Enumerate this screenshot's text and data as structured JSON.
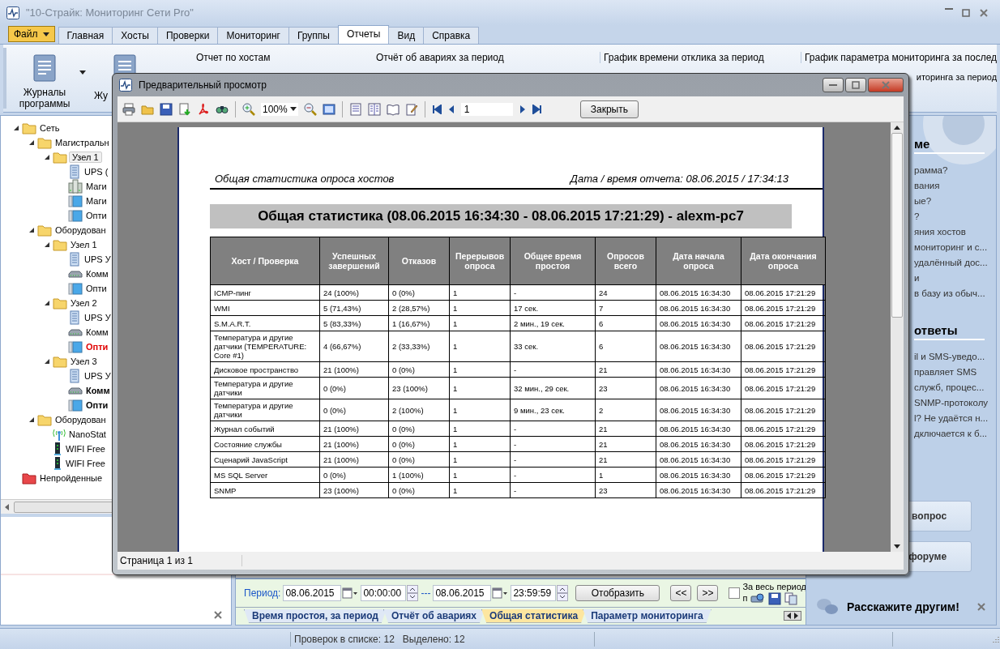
{
  "window": {
    "title": "\"10-Страйк: Мониторинг Сети Pro\""
  },
  "ribbon": {
    "file_menu": "Файл",
    "tabs": [
      {
        "label": "Главная",
        "selected": false
      },
      {
        "label": "Хосты",
        "selected": false
      },
      {
        "label": "Проверки",
        "selected": false
      },
      {
        "label": "Мониторинг",
        "selected": false
      },
      {
        "label": "Группы",
        "selected": false
      },
      {
        "label": "Отчеты",
        "selected": true
      },
      {
        "label": "Вид",
        "selected": false
      },
      {
        "label": "Справка",
        "selected": false
      }
    ],
    "big_buttons": [
      "Журналы программы",
      "Жу"
    ],
    "links": [
      "Отчет по хостам",
      "Отчёт об авариях за период",
      "График времени отклика за период",
      "График параметра мониторинга за послед"
    ],
    "links_row_2": [
      "иторинга за период"
    ]
  },
  "tree": [
    {
      "label": "Сеть",
      "kind": "folder",
      "expanded": true,
      "selected": false,
      "alarm": false,
      "emphasized": false,
      "children": [
        {
          "label": "Магистральн",
          "kind": "folder",
          "expanded": true,
          "selected": false,
          "alarm": false,
          "emphasized": false,
          "children": [
            {
              "label": "Узел 1",
              "kind": "folder",
              "expanded": true,
              "selected": true,
              "alarm": false,
              "emphasized": false,
              "children": [
                {
                  "label": "UPS (",
                  "kind": "ups",
                  "selected": false,
                  "alarm": false,
                  "emphasized": false
                },
                {
                  "label": "Маги",
                  "kind": "server",
                  "selected": false,
                  "alarm": false,
                  "emphasized": false
                },
                {
                  "label": "Маги",
                  "kind": "monitor",
                  "selected": false,
                  "alarm": false,
                  "emphasized": false
                },
                {
                  "label": "Опти",
                  "kind": "monitor",
                  "selected": false,
                  "alarm": false,
                  "emphasized": false
                }
              ]
            }
          ]
        },
        {
          "label": "Оборудован",
          "kind": "folder",
          "expanded": true,
          "selected": false,
          "alarm": false,
          "emphasized": false,
          "children": [
            {
              "label": "Узел 1",
              "kind": "folder",
              "expanded": true,
              "selected": false,
              "alarm": false,
              "emphasized": false,
              "children": [
                {
                  "label": "UPS У",
                  "kind": "ups",
                  "selected": false,
                  "alarm": false,
                  "emphasized": false
                },
                {
                  "label": "Комм",
                  "kind": "switch",
                  "selected": false,
                  "alarm": false,
                  "emphasized": false
                },
                {
                  "label": "Опти",
                  "kind": "monitor",
                  "selected": false,
                  "alarm": false,
                  "emphasized": false
                }
              ]
            },
            {
              "label": "Узел 2",
              "kind": "folder",
              "expanded": true,
              "selected": false,
              "alarm": false,
              "emphasized": false,
              "children": [
                {
                  "label": "UPS У",
                  "kind": "ups",
                  "selected": false,
                  "alarm": false,
                  "emphasized": false
                },
                {
                  "label": "Комм",
                  "kind": "switch",
                  "selected": false,
                  "alarm": false,
                  "emphasized": false
                },
                {
                  "label": "Опти",
                  "kind": "monitor",
                  "selected": false,
                  "alarm": true,
                  "emphasized": false
                }
              ]
            },
            {
              "label": "Узел 3",
              "kind": "folder",
              "expanded": true,
              "selected": false,
              "alarm": false,
              "emphasized": false,
              "children": [
                {
                  "label": "UPS У",
                  "kind": "ups",
                  "selected": false,
                  "alarm": false,
                  "emphasized": false
                },
                {
                  "label": "Комм",
                  "kind": "switch",
                  "selected": false,
                  "alarm": false,
                  "emphasized": true
                },
                {
                  "label": "Опти",
                  "kind": "monitor",
                  "selected": false,
                  "alarm": false,
                  "emphasized": true
                }
              ]
            }
          ]
        },
        {
          "label": "Оборудован",
          "kind": "folder",
          "expanded": true,
          "selected": false,
          "alarm": false,
          "emphasized": false,
          "children": [
            {
              "label": "NanoStat",
              "kind": "antenna",
              "selected": false,
              "alarm": false,
              "emphasized": false
            },
            {
              "label": "WIFI Free",
              "kind": "wifi",
              "selected": false,
              "alarm": false,
              "emphasized": false
            },
            {
              "label": "WIFI Free",
              "kind": "wifi",
              "selected": false,
              "alarm": false,
              "emphasized": false
            }
          ]
        }
      ]
    },
    {
      "label": "Непройденные",
      "kind": "failed-folder",
      "selected": false,
      "alarm": false,
      "emphasized": false
    }
  ],
  "report_controls": {
    "period_label": "Период:",
    "date_from": "08.06.2015",
    "time_from": "00:00:00",
    "separator": "---",
    "date_to": "08.06.2015",
    "time_to": "23:59:59",
    "show_button": "Отобразить",
    "prev_button": "<<",
    "next_button": ">>",
    "whole_period": {
      "label": "За весь период",
      "checked": false
    },
    "whole_period_rest": "п"
  },
  "report_tabs": [
    {
      "label": "Время простоя, за период",
      "selected": false
    },
    {
      "label": "Отчёт об авариях",
      "selected": false
    },
    {
      "label": "Общая статистика",
      "selected": true
    },
    {
      "label": "Параметр мониторинга",
      "selected": false
    }
  ],
  "help_panel": {
    "sections": [
      {
        "heading": "ме",
        "links": [
          "рамма?",
          "вания",
          "ые?",
          "?",
          "яния хостов",
          "мониторинг и с...",
          "удалённый дос...",
          "и",
          "в базу из обыч..."
        ]
      },
      {
        "heading": "ответы",
        "links": [
          "il и SMS-уведо...",
          "правляет SMS",
          "служб, процес...",
          "SNMP-протоколу",
          "l? Не удаётся н...",
          "дключается к б..."
        ]
      }
    ],
    "buttons": [
      "вопрос",
      "форуме"
    ],
    "share": "Расскажите другим!"
  },
  "status_bar": {
    "items": [
      "Проверок в списке: 12",
      "Выделено: 12"
    ]
  },
  "preview": {
    "title": "Предварительный просмотр",
    "zoom": "100%",
    "page": "1",
    "close_button": "Закрыть",
    "status": "Страница 1 из 1",
    "report": {
      "header_left": "Общая статистика опроса хостов",
      "header_right": "Дата / время отчета: 08.06.2015 / 17:34:13",
      "title": "Общая статистика (08.06.2015 16:34:30 - 08.06.2015 17:21:29) - alexm-pc7",
      "columns": [
        "Хост / Проверка",
        "Успешных завершений",
        "Отказов",
        "Перерывов опроса",
        "Общее время простоя",
        "Опросов всего",
        "Дата начала опроса",
        "Дата окончания опроса"
      ],
      "rows": [
        [
          "ICMP-пинг",
          "24 (100%)",
          "0 (0%)",
          "1",
          "-",
          "24",
          "08.06.2015 16:34:30",
          "08.06.2015 17:21:29"
        ],
        [
          "WMI",
          "5 (71,43%)",
          "2 (28,57%)",
          "1",
          "17 сек.",
          "7",
          "08.06.2015 16:34:30",
          "08.06.2015 17:21:29"
        ],
        [
          "S.M.A.R.T.",
          "5 (83,33%)",
          "1 (16,67%)",
          "1",
          "2 мин., 19 сек.",
          "6",
          "08.06.2015 16:34:30",
          "08.06.2015 17:21:29"
        ],
        [
          "Температура и другие датчики (TEMPERATURE: Core #1)",
          "4 (66,67%)",
          "2 (33,33%)",
          "1",
          "33 сек.",
          "6",
          "08.06.2015 16:34:30",
          "08.06.2015 17:21:29"
        ],
        [
          "Дисковое пространство",
          "21 (100%)",
          "0 (0%)",
          "1",
          "-",
          "21",
          "08.06.2015 16:34:30",
          "08.06.2015 17:21:29"
        ],
        [
          "Температура и другие датчики",
          "0 (0%)",
          "23 (100%)",
          "1",
          "32 мин., 29 сек.",
          "23",
          "08.06.2015 16:34:30",
          "08.06.2015 17:21:29"
        ],
        [
          "Температура и другие датчики",
          "0 (0%)",
          "2 (100%)",
          "1",
          "9 мин., 23 сек.",
          "2",
          "08.06.2015 16:34:30",
          "08.06.2015 17:21:29"
        ],
        [
          "Журнал событий",
          "21 (100%)",
          "0 (0%)",
          "1",
          "-",
          "21",
          "08.06.2015 16:34:30",
          "08.06.2015 17:21:29"
        ],
        [
          "Состояние службы",
          "21 (100%)",
          "0 (0%)",
          "1",
          "-",
          "21",
          "08.06.2015 16:34:30",
          "08.06.2015 17:21:29"
        ],
        [
          "Сценарий JavaScript",
          "21 (100%)",
          "0 (0%)",
          "1",
          "-",
          "21",
          "08.06.2015 16:34:30",
          "08.06.2015 17:21:29"
        ],
        [
          "MS SQL Server",
          "0 (0%)",
          "1 (100%)",
          "1",
          "-",
          "1",
          "08.06.2015 16:34:30",
          "08.06.2015 17:21:29"
        ],
        [
          "SNMP",
          "23 (100%)",
          "0 (0%)",
          "1",
          "-",
          "23",
          "08.06.2015 16:34:30",
          "08.06.2015 17:21:29"
        ]
      ]
    }
  }
}
